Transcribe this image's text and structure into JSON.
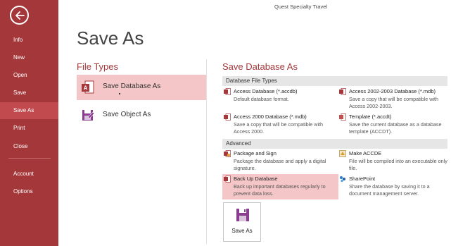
{
  "app": {
    "title": "Quest Specialty Travel"
  },
  "sidebar": {
    "items": [
      {
        "label": "Info"
      },
      {
        "label": "New"
      },
      {
        "label": "Open"
      },
      {
        "label": "Save"
      },
      {
        "label": "Save As",
        "selected": true
      },
      {
        "label": "Print"
      },
      {
        "label": "Close"
      },
      {
        "label": "Account"
      },
      {
        "label": "Options"
      }
    ]
  },
  "page": {
    "title": "Save As"
  },
  "file_types": {
    "heading": "File Types",
    "items": [
      {
        "label": "Save Database As",
        "selected": true,
        "icon": "access-db-icon"
      },
      {
        "label": "Save Object As",
        "selected": false,
        "icon": "save-object-icon"
      }
    ]
  },
  "save_db_as": {
    "heading": "Save Database As",
    "sections": [
      {
        "title": "Database File Types"
      },
      {
        "title": "Advanced"
      }
    ],
    "options": [
      {
        "title": "Access Database (*.accdb)",
        "desc": "Default database format."
      },
      {
        "title": "Access 2002-2003 Database (*.mdb)",
        "desc": "Save a copy that will be compatible with Access 2002-2003."
      },
      {
        "title": "Access 2000 Database (*.mdb)",
        "desc": "Save a copy that will be compatible with Access 2000."
      },
      {
        "title": "Template (*.accdt)",
        "desc": "Save the current database as a database template (ACCDT)."
      },
      {
        "title": "Package and Sign",
        "desc": "Package the database and apply a digital signature."
      },
      {
        "title": "Make ACCDE",
        "desc": "File will be compiled into an executable only file."
      },
      {
        "title": "Back Up Database",
        "desc": "Back up important databases regularly to prevent data loss.",
        "selected": true
      },
      {
        "title": "SharePoint",
        "desc": "Share the database by saving it to a document management server."
      }
    ],
    "save_button": {
      "label": "Save As"
    }
  },
  "colors": {
    "accent": "#a4373a",
    "selected": "#f4c6c7",
    "sidebar_active": "#c14a4f"
  }
}
